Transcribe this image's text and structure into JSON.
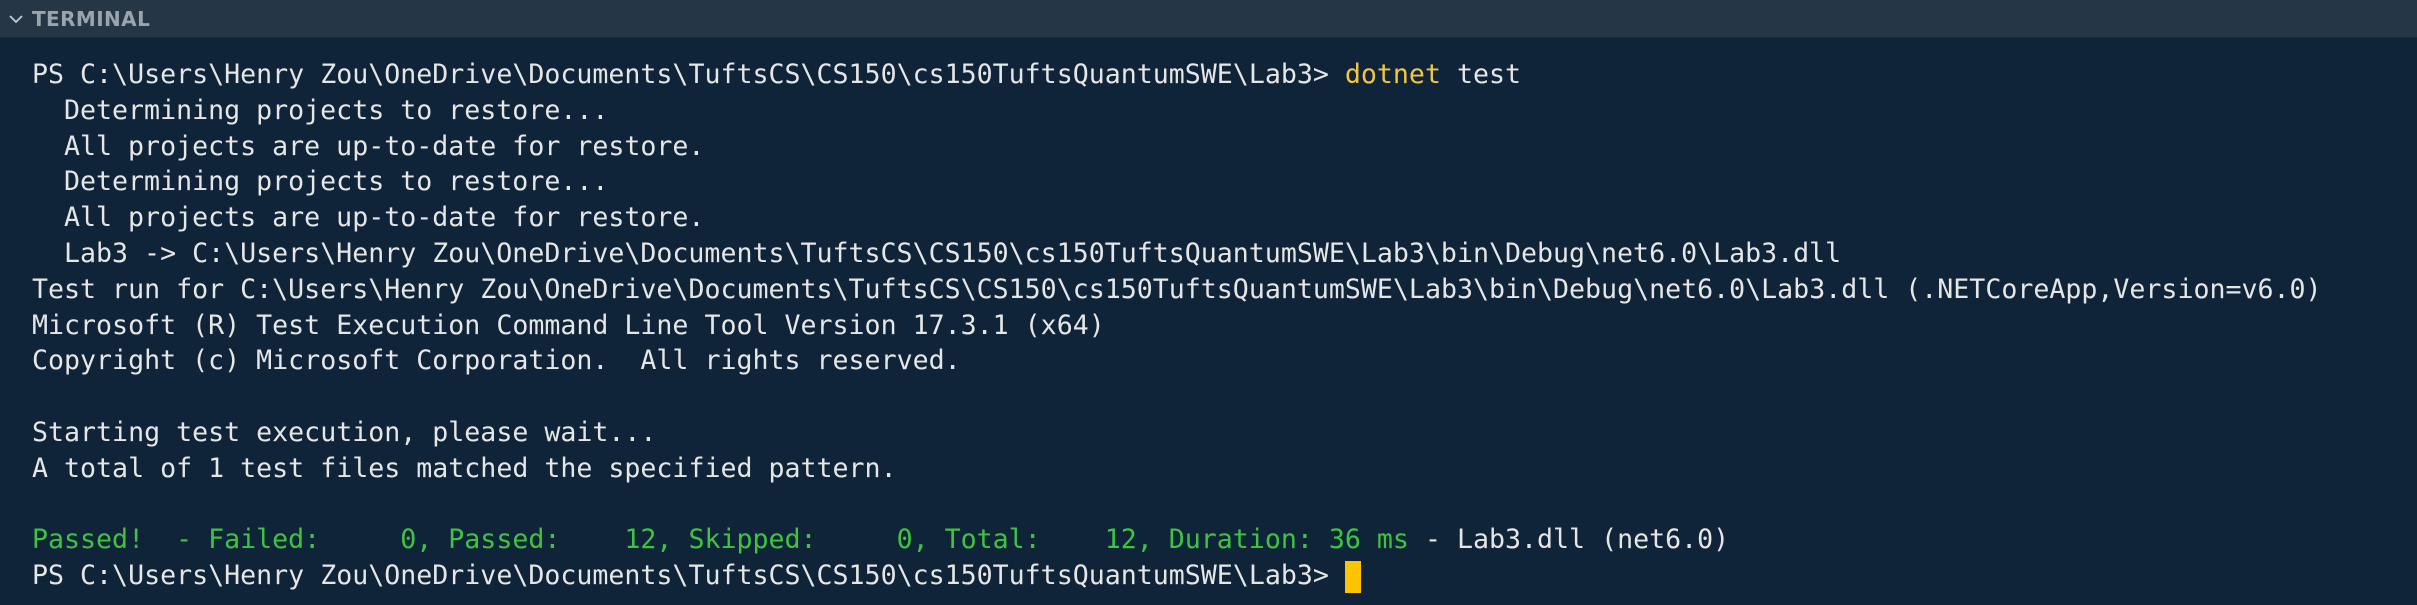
{
  "panel": {
    "title": "TERMINAL",
    "collapse_icon": "chevron-down-icon"
  },
  "terminal": {
    "prompt1": "PS C:\\Users\\Henry Zou\\OneDrive\\Documents\\TuftsCS\\CS150\\cs150TuftsQuantumSWE\\Lab3>",
    "command_keyword": "dotnet",
    "command_args": "test",
    "output": [
      "Determining projects to restore...",
      "All projects are up-to-date for restore.",
      "Determining projects to restore...",
      "All projects are up-to-date for restore.",
      "Lab3 -> C:\\Users\\Henry Zou\\OneDrive\\Documents\\TuftsCS\\CS150\\cs150TuftsQuantumSWE\\Lab3\\bin\\Debug\\net6.0\\Lab3.dll",
      "Test run for C:\\Users\\Henry Zou\\OneDrive\\Documents\\TuftsCS\\CS150\\cs150TuftsQuantumSWE\\Lab3\\bin\\Debug\\net6.0\\Lab3.dll (.NETCoreApp,Version=v6.0)",
      "Microsoft (R) Test Execution Command Line Tool Version 17.3.1 (x64)",
      "Copyright (c) Microsoft Corporation.  All rights reserved.",
      "",
      "Starting test execution, please wait...",
      "A total of 1 test files matched the specified pattern.",
      ""
    ],
    "result_summary": "Passed!  - Failed:     0, Passed:    12, Skipped:     0, Total:    12, Duration: 36 ms",
    "result_tail": " - Lab3.dll (net6.0)",
    "prompt2": "PS C:\\Users\\Henry Zou\\OneDrive\\Documents\\TuftsCS\\CS150\\cs150TuftsQuantumSWE\\Lab3>"
  },
  "colors": {
    "background": "#0f2438",
    "header_background": "#253646",
    "command": "#f2c641",
    "passed": "#3ec440",
    "cursor": "#ffc400"
  }
}
